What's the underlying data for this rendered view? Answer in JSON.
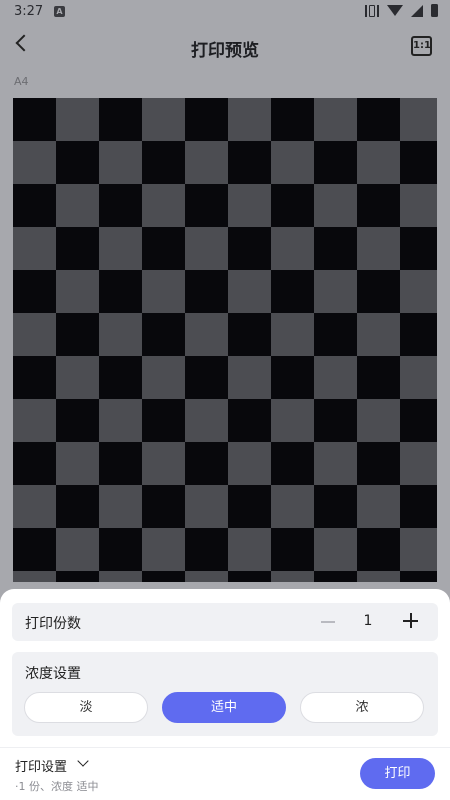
{
  "status_bar": {
    "time": "3:27",
    "notif_letter": "A"
  },
  "app_bar": {
    "title": "打印预览",
    "ratio_label": "1:1"
  },
  "paper_size": "A4",
  "copies": {
    "label": "打印份数",
    "value": "1"
  },
  "density": {
    "label": "浓度设置",
    "options": [
      "淡",
      "适中",
      "浓"
    ],
    "selected": "适中",
    "accent_color": "#5f6bf0"
  },
  "footer": {
    "settings_title": "打印设置",
    "summary": "·1 份、浓度 适中",
    "print_label": "打印"
  },
  "icons": [
    "back-icon",
    "ratio-icon",
    "chevron-down-icon",
    "minus-icon",
    "plus-icon",
    "vibrate-icon",
    "wifi-icon",
    "signal-icon",
    "battery-icon"
  ]
}
